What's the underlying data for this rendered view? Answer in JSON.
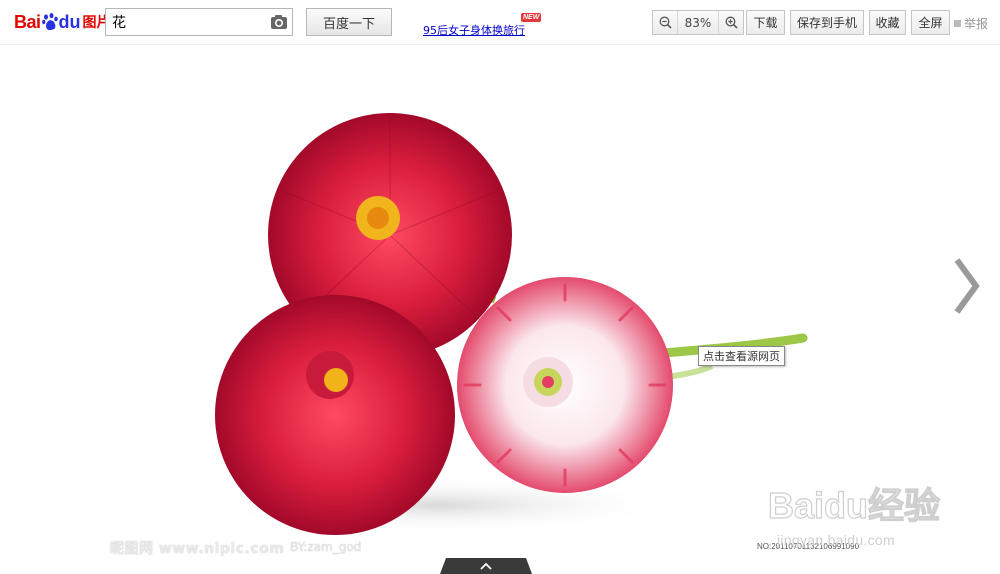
{
  "logo": {
    "bai": "Bai",
    "du": "du",
    "pic": "图片"
  },
  "search": {
    "value": "花"
  },
  "search_button": "百度一下",
  "promo_link": "95后女子身体换旅行",
  "new_badge": "NEW",
  "zoom": {
    "value": "83%"
  },
  "toolbar": {
    "download": "下载",
    "save_phone": "保存到手机",
    "favorite": "收藏",
    "fullscreen": "全屏",
    "report": "举报"
  },
  "image": {
    "tooltip": "点击查看源网页",
    "watermark_site": "昵图网 www.nipic.com",
    "watermark_by": "BY:zam_god",
    "watermark_no": "NO:20110701132106991090"
  },
  "baidu_watermark": {
    "brand": "Baidu经验",
    "url": "jingyan.baidu.com"
  },
  "colors": {
    "brand_red": "#e10602",
    "brand_blue": "#2932e1",
    "link": "#0000cc"
  }
}
